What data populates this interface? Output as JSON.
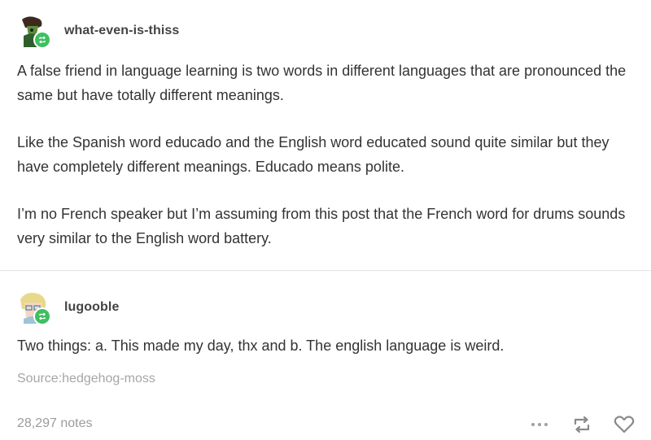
{
  "post": {
    "reblogs": [
      {
        "username": "what-even-is-thiss",
        "paragraphs": [
          "A false friend in language learning is two words in different languages that are pronounced the same but have totally different meanings.",
          "Like the Spanish word educado and the English word educated sound quite similar but they have completely different meanings. Educado means polite.",
          "I’m no French speaker but I’m assuming from this post that the French word for drums sounds very similar to the English word battery."
        ]
      },
      {
        "username": "lugooble",
        "paragraphs": [
          "Two things: a. This made my day, thx and b. The english language is weird."
        ]
      }
    ],
    "source": "Source:hedgehog-moss",
    "notes": "28,297 notes"
  },
  "icons": {
    "reblog_badge": "reblog-icon",
    "more": "more-icon",
    "reblog": "reblog-icon",
    "like": "heart-icon"
  },
  "colors": {
    "badge_green": "#3fbf61",
    "text": "#333333",
    "muted": "#a6a6a6"
  }
}
